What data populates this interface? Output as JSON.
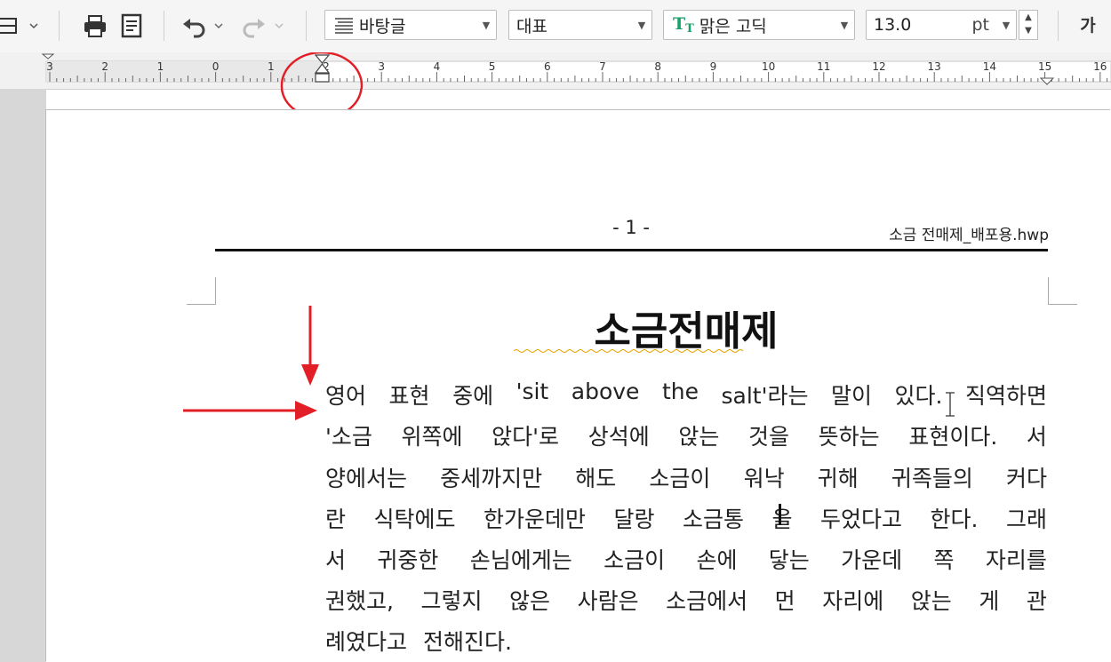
{
  "toolbar": {
    "style_combo": "바탕글",
    "para_combo": "대표",
    "font_combo": "맑은 고딕",
    "size_value": "13.0",
    "size_unit": "pt",
    "font_glyph": "가"
  },
  "ruler": {
    "labels": [
      "3",
      "2",
      "1",
      "0",
      "1",
      "2",
      "3",
      "4",
      "5",
      "6",
      "7",
      "8",
      "9",
      "10",
      "11",
      "12",
      "13",
      "14",
      "15",
      "16"
    ]
  },
  "header": {
    "page_number": "- 1 -",
    "filename": "소금 전매제_배포용.hwp"
  },
  "document": {
    "title": "소금전매제",
    "lines": [
      [
        "영어",
        "표현",
        "중에",
        "'sit",
        "above",
        "the",
        "salt'라는",
        "말이",
        "있다.",
        "직역하면"
      ],
      [
        "'소금",
        "위쪽에",
        "앉다'로",
        "상석에",
        "앉는",
        "것을",
        "뜻하는",
        "표현이다.",
        "서"
      ],
      [
        "양에서는",
        "중세까지만",
        "해도",
        "소금이",
        "워낙",
        "귀해",
        "귀족들의",
        "커다"
      ],
      [
        "란",
        "식탁에도",
        "한가운데만",
        "달랑",
        "소금통",
        "을",
        "두었다고",
        "한다.",
        "그래"
      ],
      [
        "서",
        "귀중한",
        "손님에게는",
        "소금이",
        "손에",
        "닿는",
        "가운데",
        "쪽",
        "자리를"
      ],
      [
        "권했고,",
        "그렇지",
        "않은",
        "사람은",
        "소금에서",
        "먼",
        "자리에",
        "앉는",
        "게",
        "관"
      ],
      [
        "례였다고",
        "전해진다."
      ]
    ]
  },
  "colors": {
    "annotation": "#e21e26",
    "text": "#222222",
    "toolbar_bg": "#f5f5f5"
  }
}
